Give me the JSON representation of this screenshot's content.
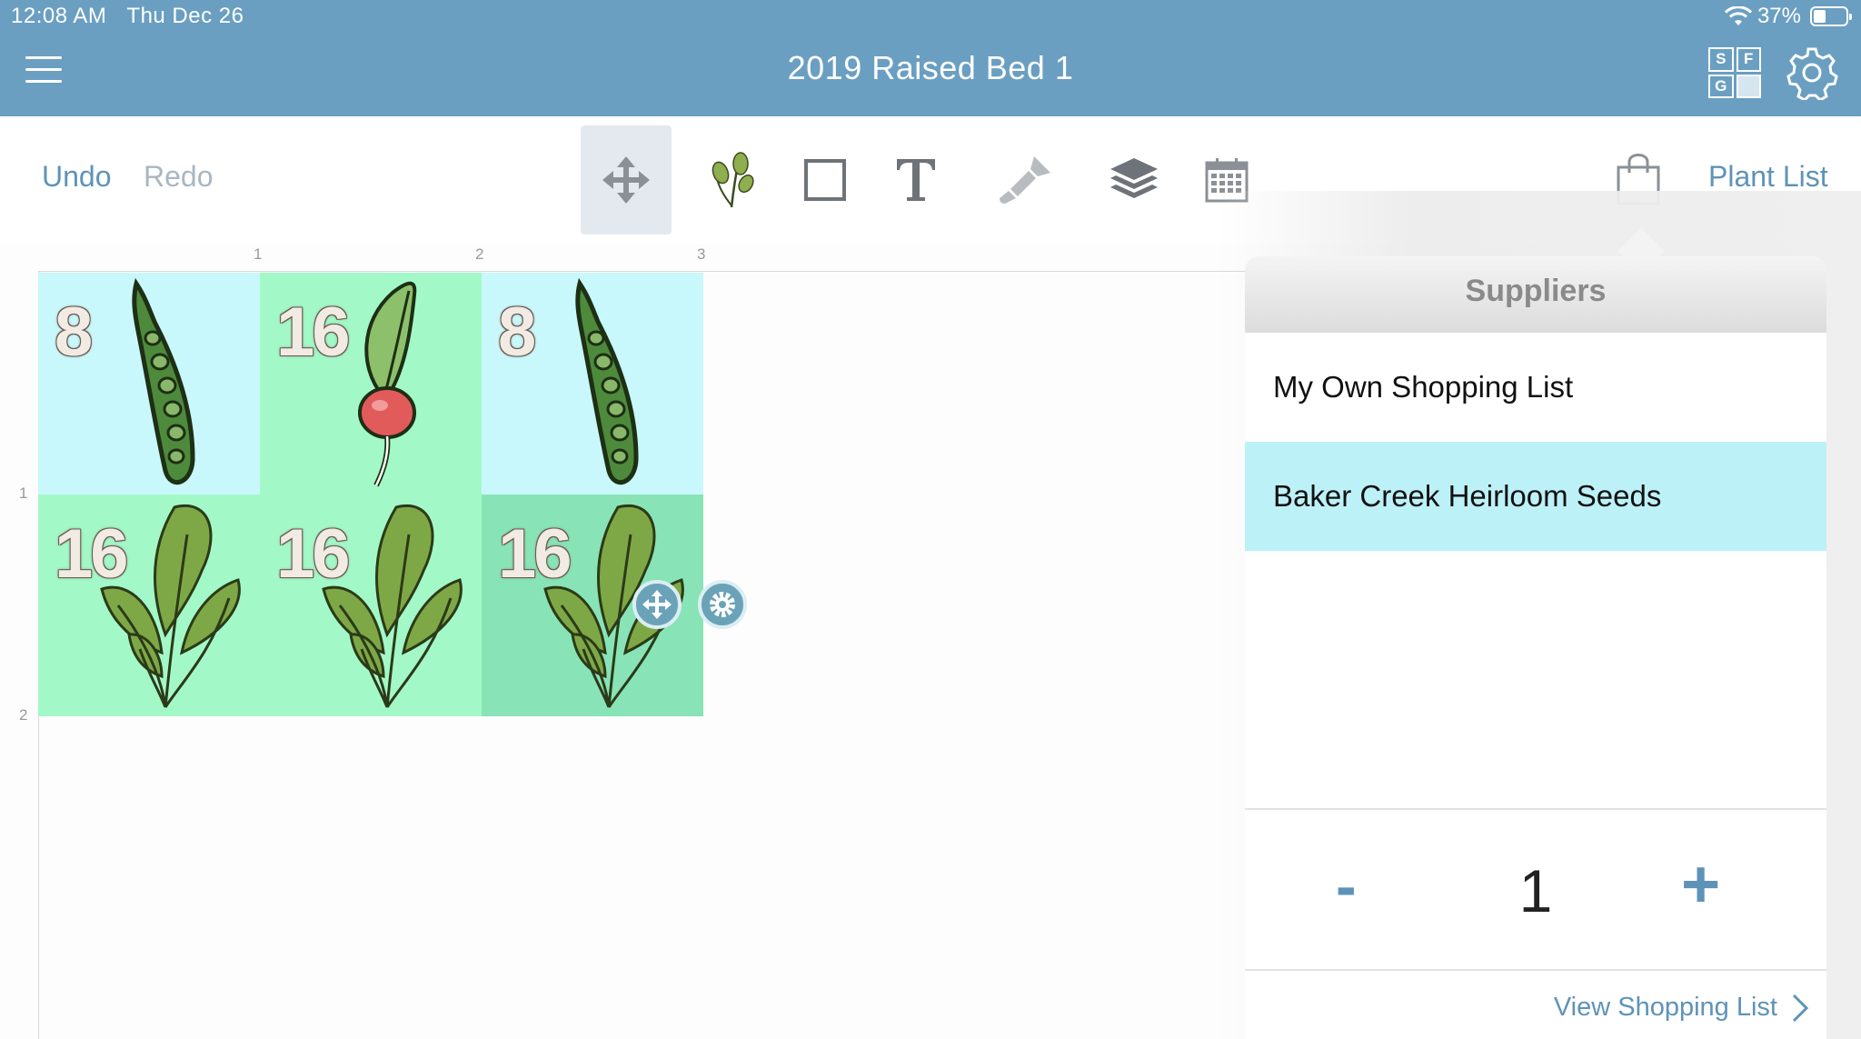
{
  "status_bar": {
    "time": "12:08 AM",
    "date": "Thu Dec 26",
    "battery": "37%"
  },
  "header": {
    "title": "2019 Raised Bed 1",
    "sfg_letters": [
      "S",
      "F",
      "G"
    ]
  },
  "toolbar": {
    "undo_label": "Undo",
    "redo_label": "Redo",
    "tools": [
      "move-icon",
      "plant-icon",
      "square-icon",
      "text-icon",
      "paint-brush-icon",
      "layers-icon",
      "calendar-icon"
    ],
    "plant_list_label": "Plant List"
  },
  "grid": {
    "ruler_columns": [
      "1",
      "2",
      "3"
    ],
    "ruler_rows": [
      "1",
      "2"
    ],
    "cells": [
      {
        "count": "8",
        "plant": "pea"
      },
      {
        "count": "16",
        "plant": "radish"
      },
      {
        "count": "8",
        "plant": "pea"
      },
      {
        "count": "16",
        "plant": "arugula"
      },
      {
        "count": "16",
        "plant": "arugula"
      },
      {
        "count": "16",
        "plant": "arugula"
      }
    ]
  },
  "suppliers": {
    "title": "Suppliers",
    "items": [
      "My Own Shopping List",
      "Baker Creek Heirloom Seeds"
    ],
    "selected": "Baker Creek Heirloom Seeds",
    "quantity": "1",
    "minus_label": "-",
    "plus_label": "+",
    "view_label": "View Shopping List"
  },
  "colors": {
    "header_bar": "#6a9fc2",
    "accent": "#5e93b8",
    "pea_cell": "#c8f8fb",
    "green_cell": "#a3f8c8",
    "selected_cell": "#88e4b6",
    "selected_row": "#bdf1f8"
  }
}
